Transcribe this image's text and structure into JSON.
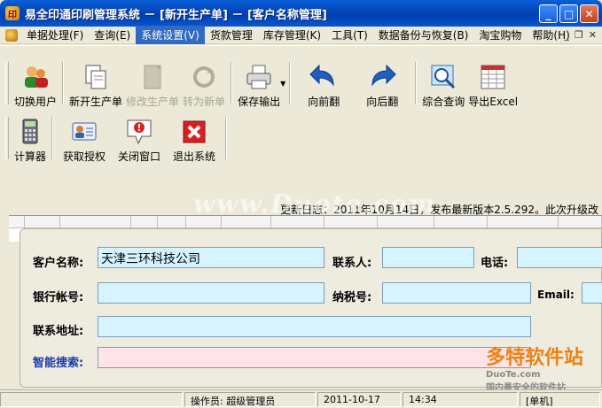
{
  "window": {
    "title": "易全印通印刷管理系统 － [新开生产单] － [客户名称管理]"
  },
  "menu": {
    "items": [
      {
        "label": "单据处理(F)"
      },
      {
        "label": "查询(E)"
      },
      {
        "label": "系统设置(V)"
      },
      {
        "label": "货款管理"
      },
      {
        "label": "库存管理(K)"
      },
      {
        "label": "工具(T)"
      },
      {
        "label": "数据备份与恢复(B)"
      },
      {
        "label": "淘宝购物"
      },
      {
        "label": "帮助(H)"
      }
    ],
    "active_index": 2
  },
  "toolbar": {
    "row1": [
      {
        "label": "切换用户",
        "icon": "switch-user-icon",
        "disabled": false
      },
      {
        "label": "新开生产单",
        "icon": "new-document-icon",
        "disabled": false
      },
      {
        "label": "修改生产单",
        "icon": "edit-document-icon",
        "disabled": true
      },
      {
        "label": "转为新单",
        "icon": "convert-icon",
        "disabled": true
      },
      {
        "label": "保存输出",
        "icon": "printer-icon",
        "disabled": false
      },
      {
        "label": "向前翻",
        "icon": "arrow-back-icon",
        "disabled": false
      },
      {
        "label": "向后翻",
        "icon": "arrow-forward-icon",
        "disabled": false
      },
      {
        "label": "综合查询",
        "icon": "search-icon",
        "disabled": false
      },
      {
        "label": "导出Excel",
        "icon": "excel-icon",
        "disabled": false
      }
    ],
    "row2": [
      {
        "label": "计算器",
        "icon": "calculator-icon"
      },
      {
        "label": "获取授权",
        "icon": "authorization-icon"
      },
      {
        "label": "关闭窗口",
        "icon": "close-window-icon"
      },
      {
        "label": "退出系统",
        "icon": "exit-icon"
      }
    ]
  },
  "news": {
    "text": "更新日志：2011年10月14日，发布最新版本2.5.292。此次升级改"
  },
  "watermark": "www.Duote.com",
  "form": {
    "customer_name_label": "客户名称:",
    "customer_name_value": "天津三环科技公司",
    "contact_label": "联系人:",
    "contact_value": "",
    "phone_label": "电话:",
    "phone_value": "",
    "bank_account_label": "银行帐号:",
    "bank_account_value": "",
    "tax_id_label": "纳税号:",
    "tax_id_value": "",
    "email_label": "Email:",
    "email_value": "",
    "address_label": "联系地址:",
    "address_value": "",
    "smart_search_label": "智能搜索:",
    "smart_search_value": ""
  },
  "status": {
    "operator": "操作员: 超级管理员",
    "date": "2011-10-17",
    "time": "14:34",
    "mode": "[单机]"
  },
  "corner_logo": {
    "brand": "多特软件站",
    "sub": "DuoTe.com",
    "tagline": "国内最安全的软件站"
  }
}
